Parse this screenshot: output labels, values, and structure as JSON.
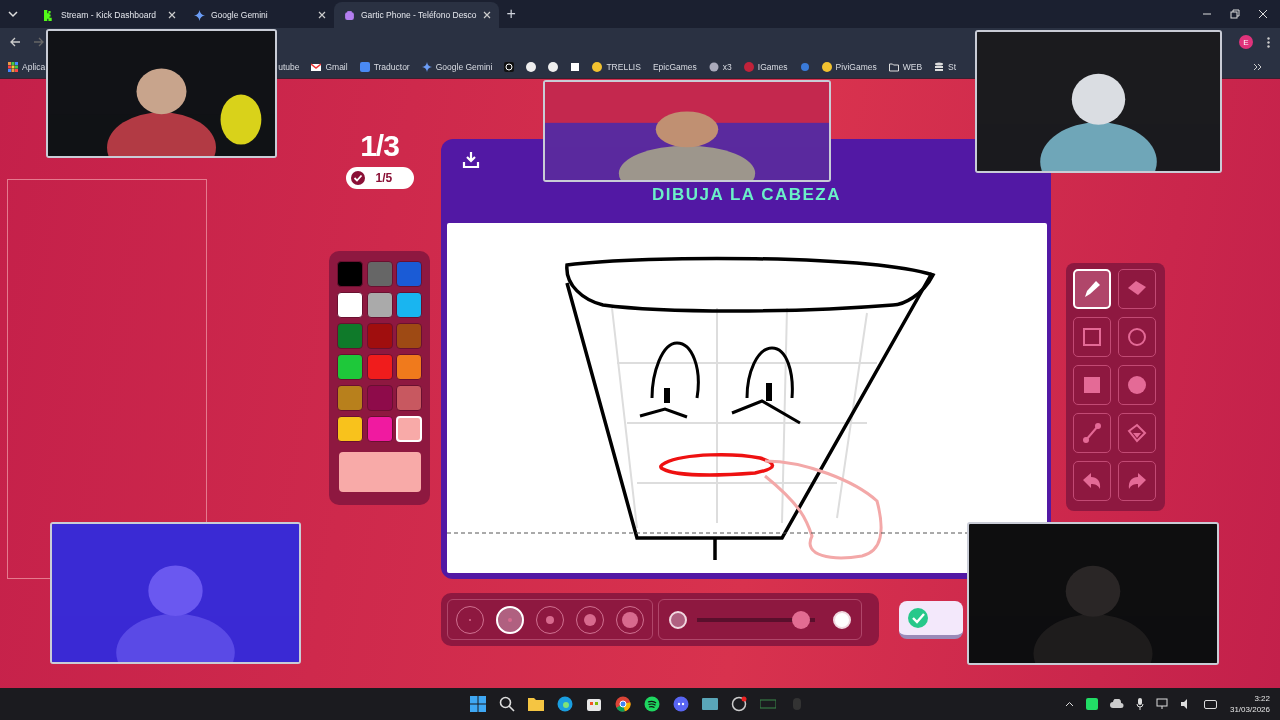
{
  "browser": {
    "tabs": [
      {
        "label": "Stream - Kick Dashboard",
        "selected": false
      },
      {
        "label": "Google Gemini",
        "selected": false
      },
      {
        "label": "Gartic Phone - Teléfono Desco",
        "selected": true
      }
    ],
    "new_tab": "+",
    "profile": "E",
    "bookmarks": [
      {
        "label": "Aplica"
      },
      {
        "label": "utube"
      },
      {
        "label": "Gmail"
      },
      {
        "label": "Traductor"
      },
      {
        "label": "Google Gemini"
      },
      {
        "kind": "icon-only"
      },
      {
        "kind": "icon-only"
      },
      {
        "kind": "icon-only"
      },
      {
        "kind": "icon-only"
      },
      {
        "label": "TRELLIS"
      },
      {
        "label": "EpicGames"
      },
      {
        "label": "x3"
      },
      {
        "label": "IGames"
      },
      {
        "kind": "icon-only"
      },
      {
        "label": "PiviGames"
      },
      {
        "label": "WEB"
      },
      {
        "label": "St"
      }
    ]
  },
  "game": {
    "round": "1/3",
    "done_count": "1/5",
    "prompt": "DIBUJA LA CABEZA",
    "palette": [
      {
        "color": "#000000",
        "selected": false
      },
      {
        "color": "#666666",
        "selected": false
      },
      {
        "color": "#1a5bd6",
        "selected": false
      },
      {
        "color": "#ffffff",
        "selected": false
      },
      {
        "color": "#aaaaaa",
        "selected": false
      },
      {
        "color": "#19b5f0",
        "selected": false
      },
      {
        "color": "#0f7a2a",
        "selected": false
      },
      {
        "color": "#a00e0e",
        "selected": false
      },
      {
        "color": "#9e4a14",
        "selected": false
      },
      {
        "color": "#1ec83a",
        "selected": false
      },
      {
        "color": "#f01c1c",
        "selected": false
      },
      {
        "color": "#f07a1c",
        "selected": false
      },
      {
        "color": "#b8801c",
        "selected": false
      },
      {
        "color": "#8e0b4a",
        "selected": false
      },
      {
        "color": "#c85860",
        "selected": false
      },
      {
        "color": "#f8c21c",
        "selected": false
      },
      {
        "color": "#f01aa0",
        "selected": false
      },
      {
        "color": "#f8aaa8",
        "selected": true
      }
    ],
    "tools": [
      {
        "kind": "pen",
        "selected": true
      },
      {
        "kind": "eraser",
        "selected": false
      },
      {
        "kind": "rect",
        "selected": false
      },
      {
        "kind": "ellipse",
        "selected": false
      },
      {
        "kind": "filled-rect",
        "selected": false
      },
      {
        "kind": "filled-ellipse",
        "selected": false
      },
      {
        "kind": "line",
        "selected": false
      },
      {
        "kind": "fill",
        "selected": false
      },
      {
        "kind": "undo",
        "selected": false
      },
      {
        "kind": "redo",
        "selected": false
      }
    ],
    "brush_sizes": [
      {
        "selected": false
      },
      {
        "selected": true
      },
      {
        "selected": false
      },
      {
        "selected": false
      },
      {
        "selected": false
      }
    ],
    "opacity": {
      "level": 0.88
    }
  },
  "taskbar": {
    "time": "3:22",
    "date": "31/03/2026"
  }
}
